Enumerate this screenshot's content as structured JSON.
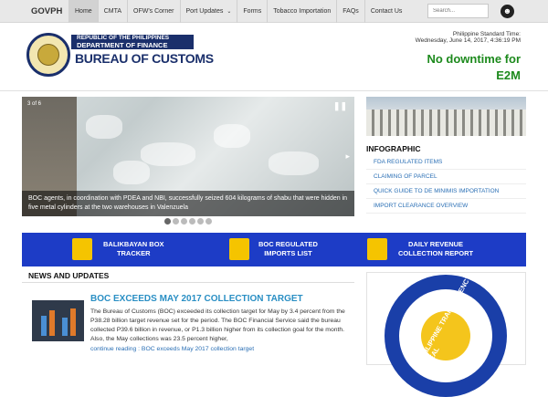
{
  "topnav": {
    "brand": "GOVPH",
    "items": [
      {
        "label": "Home",
        "active": true
      },
      {
        "label": "CMTA"
      },
      {
        "label": "OFW's Corner"
      },
      {
        "label": "Port Updates",
        "caret": true
      },
      {
        "label": "Forms"
      },
      {
        "label": "Tobacco Importation"
      },
      {
        "label": "FAQs"
      },
      {
        "label": "Contact Us"
      }
    ],
    "search_placeholder": "Search...",
    "accessibility_icon": "accessibility-icon"
  },
  "header": {
    "logo": {
      "line1": "REPUBLIC OF THE PHILIPPINES",
      "line2": "DEPARTMENT OF FINANCE",
      "line3": "BUREAU OF CUSTOMS"
    },
    "pst_label": "Philippine Standard Time:",
    "pst_time": "Wednesday, June 14, 2017, 4:36:19 PM",
    "downtime": "No downtime for E2M"
  },
  "slider": {
    "caption": "BOC agents, in coordination with PDEA and NBI, successfully seized 604 kilograms of shabu that were hidden in five metal cylinders at the two warehouses in Valenzuela",
    "counter": "3 of 6",
    "dots": 6,
    "active_dot": 0
  },
  "infographic": {
    "heading": "INFOGRAPHIC",
    "links": [
      "FDA REGULATED ITEMS",
      "CLAIMING OF PARCEL",
      "QUICK GUIDE TO DE MINIMIS IMPORTATION",
      "IMPORT CLEARANCE OVERVIEW"
    ]
  },
  "banner": {
    "items": [
      {
        "label": "BALIKBAYAN BOX TRACKER",
        "line1": "BALIKBAYAN BOX",
        "line2": "TRACKER",
        "icon": "box-icon"
      },
      {
        "label": "BOC REGULATED IMPORTS LIST",
        "line1": "BOC REGULATED",
        "line2": "IMPORTS LIST",
        "icon": "clipboard-icon"
      },
      {
        "label": "DAILY REVENUE COLLECTION REPORT",
        "line1": "DAILY REVENUE",
        "line2": "COLLECTION REPORT",
        "icon": "checklist-icon"
      }
    ],
    "color": "#1d3cc6"
  },
  "news": {
    "heading": "NEWS AND UPDATES",
    "title": "BOC EXCEEDS MAY 2017 COLLECTION TARGET",
    "body": "The Bureau of Customs (BOC) exceeded its collection target for May by 3.4 percent from the P38.28 billion target revenue set for the period. The BOC Financial Service said the bureau collected P39.6 billion in revenue, or P1.3 billion higher from its collection goal for the month. Also, the May collections was 23.5 percent higher,",
    "more": "continue reading : BOC exceeds May 2017 collection target"
  },
  "transparency_seal": {
    "text": "PHILIPPINE TRANSPARENCY SEAL"
  }
}
